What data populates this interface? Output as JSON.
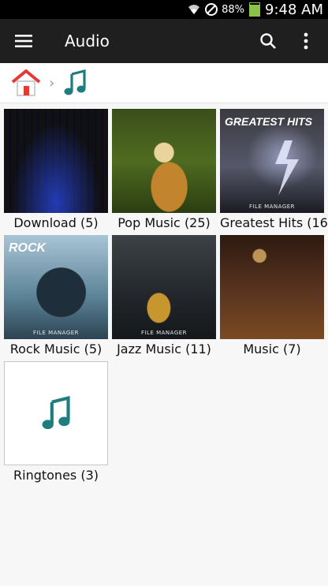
{
  "status_bar": {
    "battery": "88%",
    "time": "9:48 AM",
    "icons": [
      "wifi-icon",
      "blocked-icon",
      "battery-icon"
    ]
  },
  "app_bar": {
    "title": "Audio",
    "icons": [
      "menu-icon",
      "search-icon",
      "more-vert-icon"
    ]
  },
  "breadcrumb": {
    "icons": [
      "home-icon",
      "chevron-right-icon",
      "music-note-icon"
    ]
  },
  "folders": [
    {
      "label": "Download (5)",
      "thumb": "download"
    },
    {
      "label": "Pop Music (25)",
      "thumb": "pop"
    },
    {
      "label": "Greatest Hits (16)",
      "thumb": "greatest",
      "overlay": "GREATEST HITS",
      "watermark": "FILE MANAGER"
    },
    {
      "label": "Rock Music (5)",
      "thumb": "rock",
      "overlay": "ROCK",
      "watermark": "FILE MANAGER"
    },
    {
      "label": "Jazz Music (11)",
      "thumb": "jazz",
      "watermark": "FILE MANAGER"
    },
    {
      "label": "Music (7)",
      "thumb": "music"
    },
    {
      "label": "Ringtones (3)",
      "thumb": "ringtones"
    }
  ],
  "colors": {
    "accent": "#1e7d7d",
    "app_bar": "#1f1f1f",
    "status_bar": "#000000",
    "home_roof": "#e53935"
  }
}
